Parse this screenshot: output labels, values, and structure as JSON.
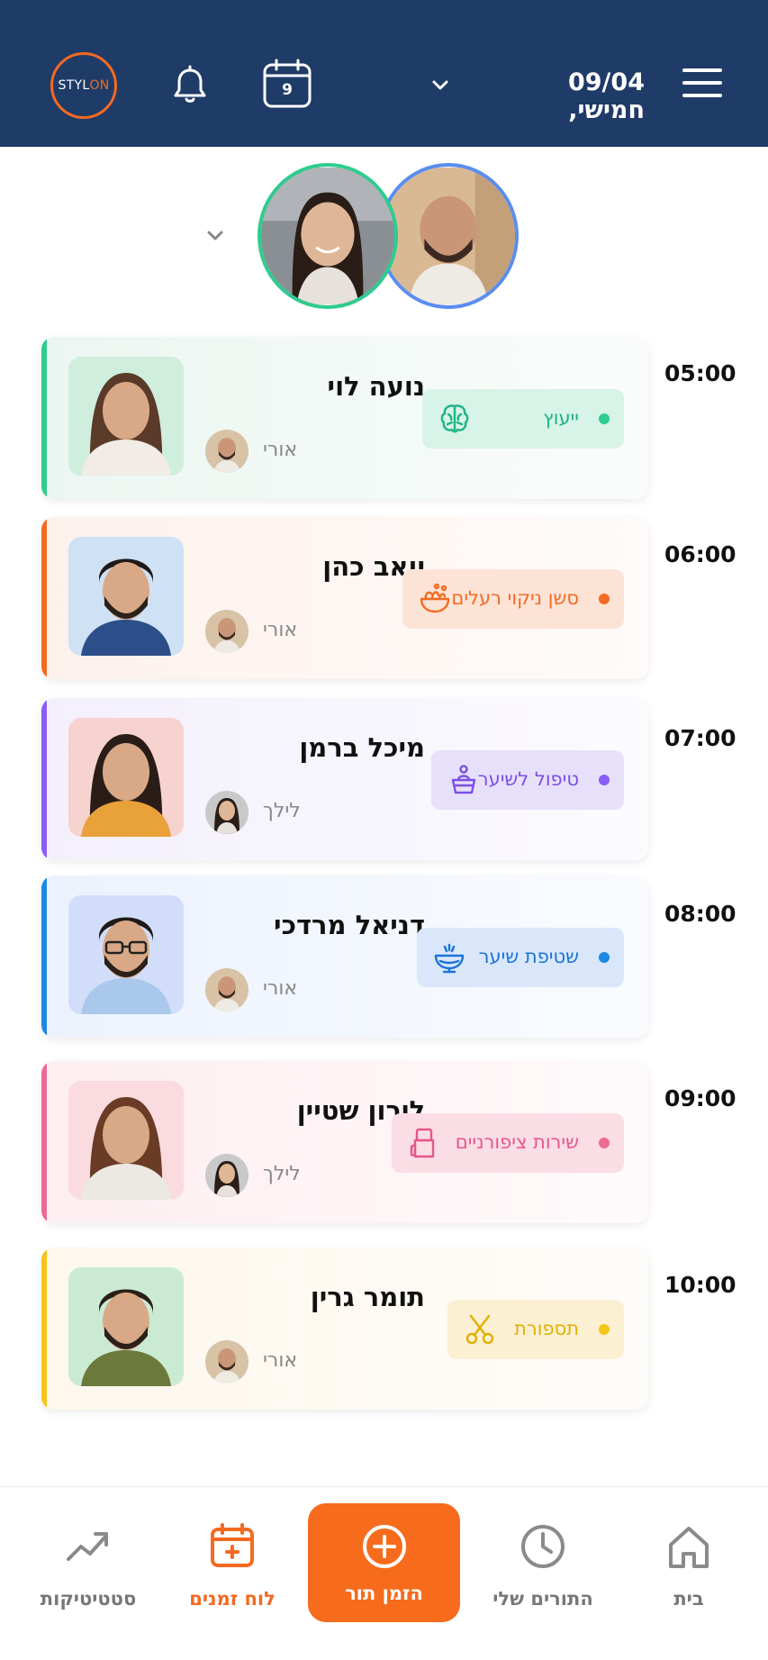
{
  "header": {
    "logo_prefix": "STYL",
    "logo_suffix": "ON",
    "calendar_day": "9",
    "date": "09/04 ,חמישי"
  },
  "appointments": [
    {
      "time": "05:00",
      "client": "נועה לוי",
      "staff": "אורי",
      "service": "ייעוץ",
      "service_icon": "brain-icon",
      "accent": "#2ecc8e"
    },
    {
      "time": "06:00",
      "client": "יואב כהן",
      "staff": "אורי",
      "service": "סשן ניקוי רעלים",
      "service_icon": "salad-bowl-icon",
      "accent": "#f36a21"
    },
    {
      "time": "07:00",
      "client": "מיכל ברמן",
      "staff": "לילך",
      "service": "טיפול לשיער",
      "service_icon": "hair-treatment-icon",
      "accent": "#8b5cf6"
    },
    {
      "time": "08:00",
      "client": "דניאל מרדכי",
      "staff": "אורי",
      "service": "שטיפת שיער",
      "service_icon": "hair-wash-icon",
      "accent": "#1e88e5"
    },
    {
      "time": "09:00",
      "client": "לירון שטיין",
      "staff": "לילך",
      "service": "שירות ציפורניים",
      "service_icon": "nail-polish-icon",
      "accent": "#ec6a93"
    },
    {
      "time": "10:00",
      "client": "תומר גרין",
      "staff": "אורי",
      "service": "תספורת",
      "service_icon": "scissors-icon",
      "accent": "#f5c518"
    }
  ],
  "nav": {
    "home": "בית",
    "my_appointments": "התורים שלי",
    "book": "הזמן תור",
    "schedule": "לוח זמנים",
    "stats": "סטטיטיקות"
  }
}
